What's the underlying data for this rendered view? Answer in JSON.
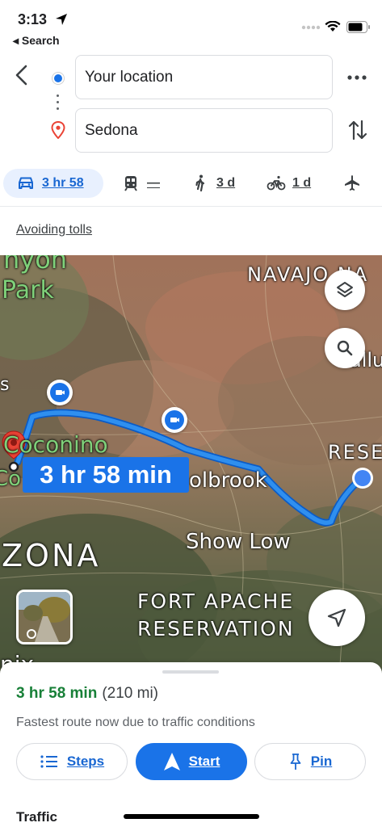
{
  "status_bar": {
    "time": "3:13",
    "back_app": "◂ Search"
  },
  "header": {
    "origin": "Your location",
    "destination": "Sedona"
  },
  "modes": [
    {
      "name": "drive",
      "label": "3 hr 58",
      "active": true
    },
    {
      "name": "transit",
      "label": "—"
    },
    {
      "name": "walk",
      "label": "3 d"
    },
    {
      "name": "bike",
      "label": "1 d"
    },
    {
      "name": "flight",
      "label": ""
    }
  ],
  "options_link": "Avoiding tolls",
  "map": {
    "duration_label": "3 hr 58 min",
    "labels": {
      "canyon": "nyon",
      "park": "Park",
      "navajo": "NAVAJO NA",
      "coconino": "Coconino",
      "holbrook": "olbrook",
      "rese": "RESE",
      "gallup": "allu",
      "zona": "ZONA",
      "show_low": "Show Low",
      "fort_apache_1": "FORT APACHE",
      "fort_apache_2": "RESERVATION",
      "co": "Co",
      "s": "s",
      "nix": "nix"
    },
    "colors": {
      "route": "#2f8fef",
      "pin": "#ea4335"
    }
  },
  "sheet": {
    "duration": "3 hr 58 min",
    "distance": "(210 mi)",
    "note": "Fastest route now due to traffic conditions",
    "buttons": {
      "steps": "Steps",
      "start": "Start",
      "pin": "Pin"
    },
    "section": "Traffic"
  }
}
